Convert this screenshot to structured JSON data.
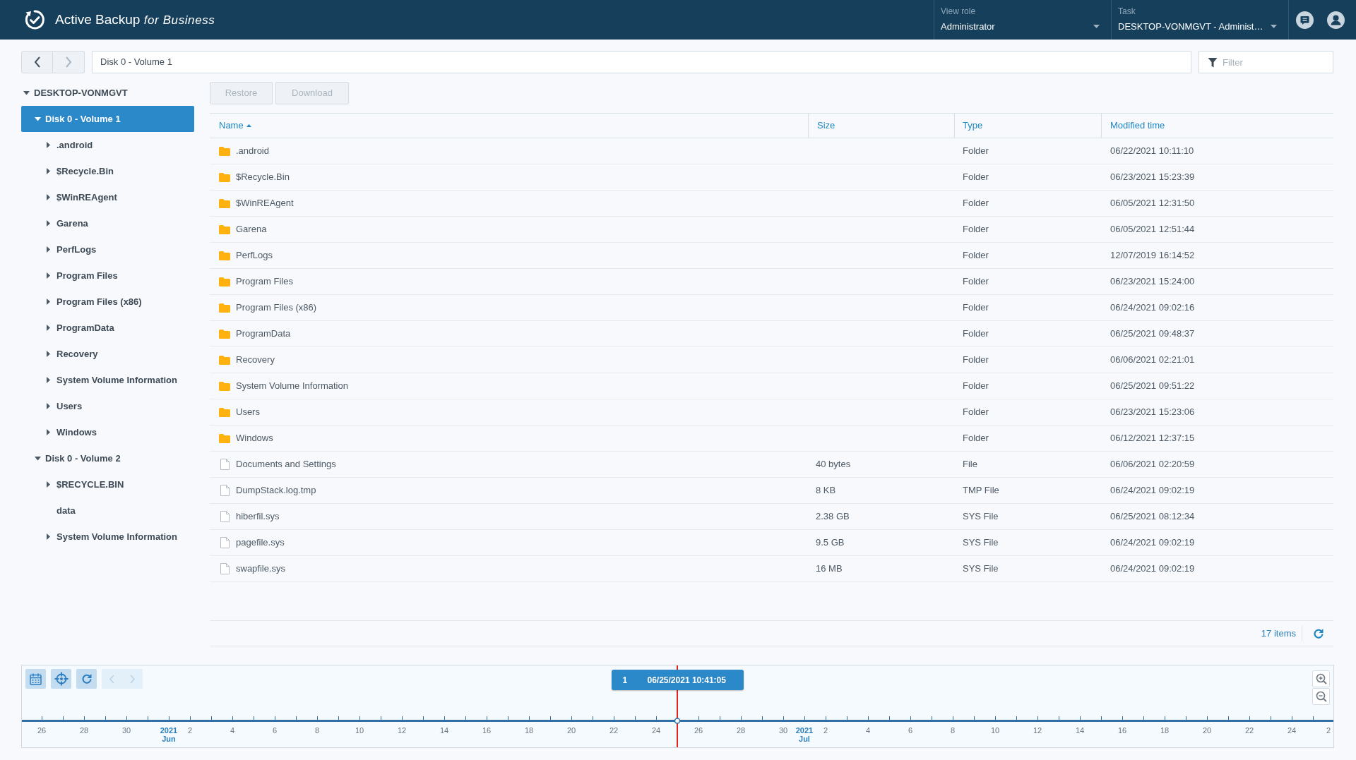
{
  "header": {
    "title": "Active Backup *for Business*",
    "view_role": {
      "label": "View role",
      "value": "Administrator"
    },
    "task": {
      "label": "Task",
      "value": "DESKTOP-VONMGVT - Administ…"
    }
  },
  "nav": {
    "back": {
      "disabled": false
    },
    "forward": {
      "disabled": true
    },
    "path": "Disk 0 - Volume 1",
    "filter": {
      "placeholder": "Filter"
    }
  },
  "sidebar": {
    "tree": [
      {
        "label": "DESKTOP-VONMGVT",
        "kind": "branch",
        "expanded": true,
        "selected": false,
        "children": [
          {
            "label": "Disk 0 - Volume 1",
            "kind": "branch",
            "expanded": true,
            "selected": true,
            "children": [
              {
                "label": ".android",
                "kind": "branch",
                "expanded": false,
                "selected": false
              },
              {
                "label": "$Recycle.Bin",
                "kind": "branch",
                "expanded": false,
                "selected": false
              },
              {
                "label": "$WinREAgent",
                "kind": "branch",
                "expanded": false,
                "selected": false
              },
              {
                "label": "Garena",
                "kind": "branch",
                "expanded": false,
                "selected": false
              },
              {
                "label": "PerfLogs",
                "kind": "branch",
                "expanded": false,
                "selected": false
              },
              {
                "label": "Program Files",
                "kind": "branch",
                "expanded": false,
                "selected": false
              },
              {
                "label": "Program Files (x86)",
                "kind": "branch",
                "expanded": false,
                "selected": false
              },
              {
                "label": "ProgramData",
                "kind": "branch",
                "expanded": false,
                "selected": false
              },
              {
                "label": "Recovery",
                "kind": "branch",
                "expanded": false,
                "selected": false
              },
              {
                "label": "System Volume Information",
                "kind": "branch",
                "expanded": false,
                "selected": false
              },
              {
                "label": "Users",
                "kind": "branch",
                "expanded": false,
                "selected": false
              },
              {
                "label": "Windows",
                "kind": "branch",
                "expanded": false,
                "selected": false
              }
            ]
          },
          {
            "label": "Disk 0 - Volume 2",
            "kind": "branch",
            "expanded": true,
            "selected": false,
            "children": [
              {
                "label": "$RECYCLE.BIN",
                "kind": "branch",
                "expanded": false,
                "selected": false
              },
              {
                "label": "data",
                "kind": "leaf",
                "selected": false
              },
              {
                "label": "System Volume Information",
                "kind": "branch",
                "expanded": false,
                "selected": false
              }
            ]
          }
        ]
      }
    ]
  },
  "toolbar": [
    {
      "label": "Restore",
      "disabled": true
    },
    {
      "label": "Download",
      "disabled": true
    }
  ],
  "table": {
    "columns": [
      {
        "label": "Name",
        "sorted": true
      },
      {
        "label": "Size",
        "sorted": false
      },
      {
        "label": "Type",
        "sorted": false
      },
      {
        "label": "Modified time",
        "sorted": false
      }
    ],
    "rows": [
      {
        "kind": "folder",
        "name": ".android",
        "type": "Folder",
        "modified": "06/22/2021 10:11:10"
      },
      {
        "kind": "folder",
        "name": "$Recycle.Bin",
        "type": "Folder",
        "modified": "06/23/2021 15:23:39"
      },
      {
        "kind": "folder",
        "name": "$WinREAgent",
        "type": "Folder",
        "modified": "06/05/2021 12:31:50"
      },
      {
        "kind": "folder",
        "name": "Garena",
        "type": "Folder",
        "modified": "06/05/2021 12:51:44"
      },
      {
        "kind": "folder",
        "name": "PerfLogs",
        "type": "Folder",
        "modified": "12/07/2019 16:14:52"
      },
      {
        "kind": "folder",
        "name": "Program Files",
        "type": "Folder",
        "modified": "06/23/2021 15:24:00"
      },
      {
        "kind": "folder",
        "name": "Program Files (x86)",
        "type": "Folder",
        "modified": "06/24/2021 09:02:16"
      },
      {
        "kind": "folder",
        "name": "ProgramData",
        "type": "Folder",
        "modified": "06/25/2021 09:48:37"
      },
      {
        "kind": "folder",
        "name": "Recovery",
        "type": "Folder",
        "modified": "06/06/2021 02:21:01"
      },
      {
        "kind": "folder",
        "name": "System Volume Information",
        "type": "Folder",
        "modified": "06/25/2021 09:51:22"
      },
      {
        "kind": "folder",
        "name": "Users",
        "type": "Folder",
        "modified": "06/23/2021 15:23:06"
      },
      {
        "kind": "folder",
        "name": "Windows",
        "type": "Folder",
        "modified": "06/12/2021 12:37:15"
      },
      {
        "kind": "file",
        "name": "Documents and Settings",
        "size": "40 bytes",
        "type": "File",
        "modified": "06/06/2021 02:20:59"
      },
      {
        "kind": "file",
        "name": "DumpStack.log.tmp",
        "size": "8 KB",
        "type": "TMP File",
        "modified": "06/24/2021 09:02:19"
      },
      {
        "kind": "file",
        "name": "hiberfil.sys",
        "size": "2.38 GB",
        "type": "SYS File",
        "modified": "06/25/2021 08:12:34"
      },
      {
        "kind": "file",
        "name": "pagefile.sys",
        "size": "9.5 GB",
        "type": "SYS File",
        "modified": "06/24/2021 09:02:19"
      },
      {
        "kind": "file",
        "name": "swapfile.sys",
        "size": "16 MB",
        "type": "SYS File",
        "modified": "06/24/2021 09:02:19"
      }
    ]
  },
  "status_bar": {
    "count": "17 items"
  },
  "timeline": {
    "prev": {
      "disabled": true
    },
    "next": {
      "disabled": true
    },
    "days": [
      {
        "kind": "day",
        "label": "26"
      },
      {
        "kind": "tick"
      },
      {
        "kind": "day",
        "label": "28"
      },
      {
        "kind": "tick"
      },
      {
        "kind": "day",
        "label": "30"
      },
      {
        "kind": "tick"
      },
      {
        "kind": "month",
        "year": "2021",
        "month": "Jun"
      },
      {
        "kind": "day",
        "label": "2"
      },
      {
        "kind": "tick"
      },
      {
        "kind": "day",
        "label": "4"
      },
      {
        "kind": "tick"
      },
      {
        "kind": "day",
        "label": "6"
      },
      {
        "kind": "tick"
      },
      {
        "kind": "day",
        "label": "8"
      },
      {
        "kind": "tick"
      },
      {
        "kind": "day",
        "label": "10"
      },
      {
        "kind": "tick"
      },
      {
        "kind": "day",
        "label": "12"
      },
      {
        "kind": "tick"
      },
      {
        "kind": "day",
        "label": "14"
      },
      {
        "kind": "tick"
      },
      {
        "kind": "day",
        "label": "16"
      },
      {
        "kind": "tick"
      },
      {
        "kind": "day",
        "label": "18"
      },
      {
        "kind": "tick"
      },
      {
        "kind": "day",
        "label": "20"
      },
      {
        "kind": "tick"
      },
      {
        "kind": "day",
        "label": "22"
      },
      {
        "kind": "tick"
      },
      {
        "kind": "day",
        "label": "24"
      },
      {
        "kind": "tick",
        "version": {
          "count": "1",
          "time": "06/25/2021 10:41:05"
        }
      },
      {
        "kind": "day",
        "label": "26"
      },
      {
        "kind": "tick"
      },
      {
        "kind": "day",
        "label": "28"
      },
      {
        "kind": "tick"
      },
      {
        "kind": "day",
        "label": "30"
      },
      {
        "kind": "month",
        "year": "2021",
        "month": "Jul"
      },
      {
        "kind": "day",
        "label": "2"
      },
      {
        "kind": "tick"
      },
      {
        "kind": "day",
        "label": "4"
      },
      {
        "kind": "tick"
      },
      {
        "kind": "day",
        "label": "6"
      },
      {
        "kind": "tick"
      },
      {
        "kind": "day",
        "label": "8"
      },
      {
        "kind": "tick"
      },
      {
        "kind": "day",
        "label": "10"
      },
      {
        "kind": "tick"
      },
      {
        "kind": "day",
        "label": "12"
      },
      {
        "kind": "tick"
      },
      {
        "kind": "day",
        "label": "14"
      },
      {
        "kind": "tick"
      },
      {
        "kind": "day",
        "label": "16"
      },
      {
        "kind": "tick"
      },
      {
        "kind": "day",
        "label": "18"
      },
      {
        "kind": "tick"
      },
      {
        "kind": "day",
        "label": "20"
      },
      {
        "kind": "tick"
      },
      {
        "kind": "day",
        "label": "22"
      },
      {
        "kind": "tick"
      },
      {
        "kind": "day",
        "label": "24"
      },
      {
        "kind": "tick"
      },
      {
        "kind": "day",
        "label": "2"
      }
    ]
  }
}
